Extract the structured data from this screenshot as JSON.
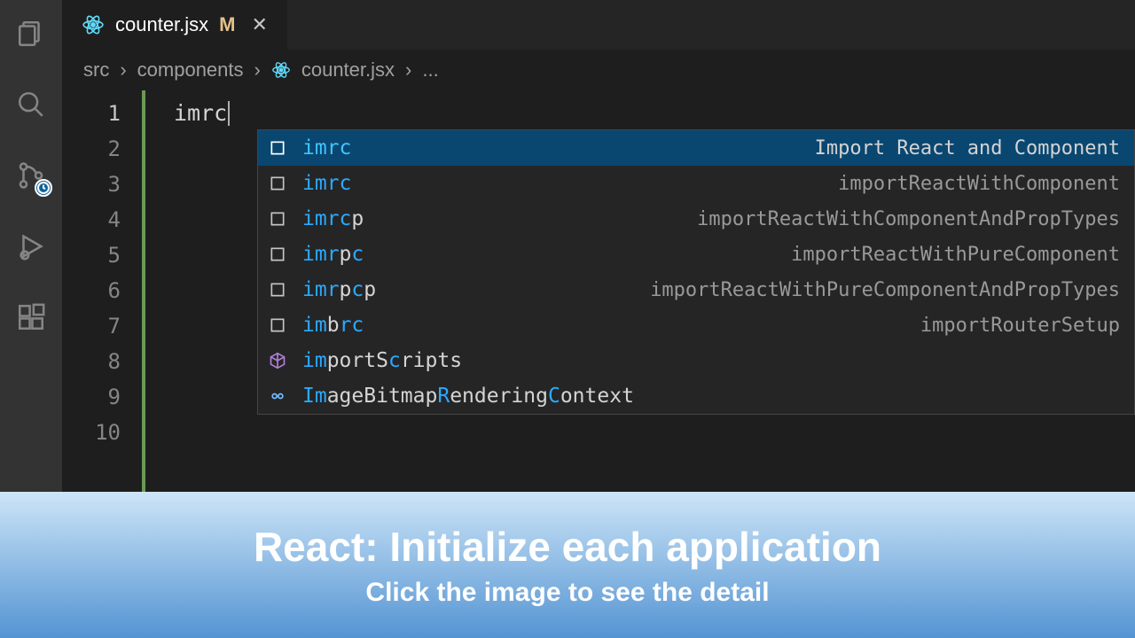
{
  "tab": {
    "filename": "counter.jsx",
    "modified_badge": "M"
  },
  "breadcrumb": {
    "seg1": "src",
    "seg2": "components",
    "seg3": "counter.jsx",
    "seg4": "..."
  },
  "editor": {
    "lines": [
      "1",
      "2",
      "3",
      "4",
      "5",
      "6",
      "7",
      "8",
      "9",
      "10"
    ],
    "typed": "imrc"
  },
  "suggestions": [
    {
      "kind": "snippet",
      "label_hl": "imrc",
      "label_rest": "",
      "detail": "Import React and Component",
      "selected": true
    },
    {
      "kind": "snippet",
      "label_hl": "imrc",
      "label_rest": "",
      "detail": "importReactWithComponent"
    },
    {
      "kind": "snippet",
      "label_hl": "imrc",
      "label_rest": "p",
      "detail": "importReactWithComponentAndPropTypes"
    },
    {
      "kind": "snippet",
      "label_hl": "imr",
      "label_mid": "p",
      "label_hl2": "c",
      "detail": "importReactWithPureComponent"
    },
    {
      "kind": "snippet",
      "label_hl": "imr",
      "label_mid": "p",
      "label_hl2": "c",
      "label_rest": "p",
      "detail": "importReactWithPureComponentAndPropTypes"
    },
    {
      "kind": "snippet",
      "label_hl": "im",
      "label_mid": "b",
      "label_hl2": "rc",
      "detail": "importRouterSetup"
    },
    {
      "kind": "module",
      "label_hl": "im",
      "label_mid": "portS",
      "label_hl2": "c",
      "label_mid2": "r",
      "label_rest": "ipts",
      "detail": ""
    },
    {
      "kind": "interface",
      "label_hl": "Im",
      "label_mid": "ageBitmap",
      "label_hl2": "R",
      "label_mid2": "endering",
      "label_hl3": "C",
      "label_rest": "ontext",
      "detail": ""
    }
  ],
  "banner": {
    "title": "React: Initialize each application",
    "subtitle": "Click the image to see the detail"
  }
}
